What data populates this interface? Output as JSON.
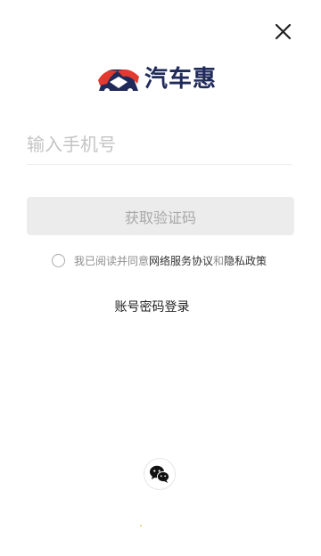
{
  "brand": {
    "name": "汽车惠",
    "primary_color": "#1f2a5a",
    "accent_color": "#e23a2e"
  },
  "header": {
    "close_icon": "close-icon"
  },
  "form": {
    "phone_placeholder": "输入手机号",
    "code_button_label": "获取验证码"
  },
  "agreement": {
    "prefix": "我已阅读并同意",
    "service_link": "网络服务协议",
    "conjunction": "和",
    "privacy_link": "隐私政策"
  },
  "alt_login": {
    "password_login_label": "账号密码登录",
    "wechat_icon": "wechat-icon"
  }
}
